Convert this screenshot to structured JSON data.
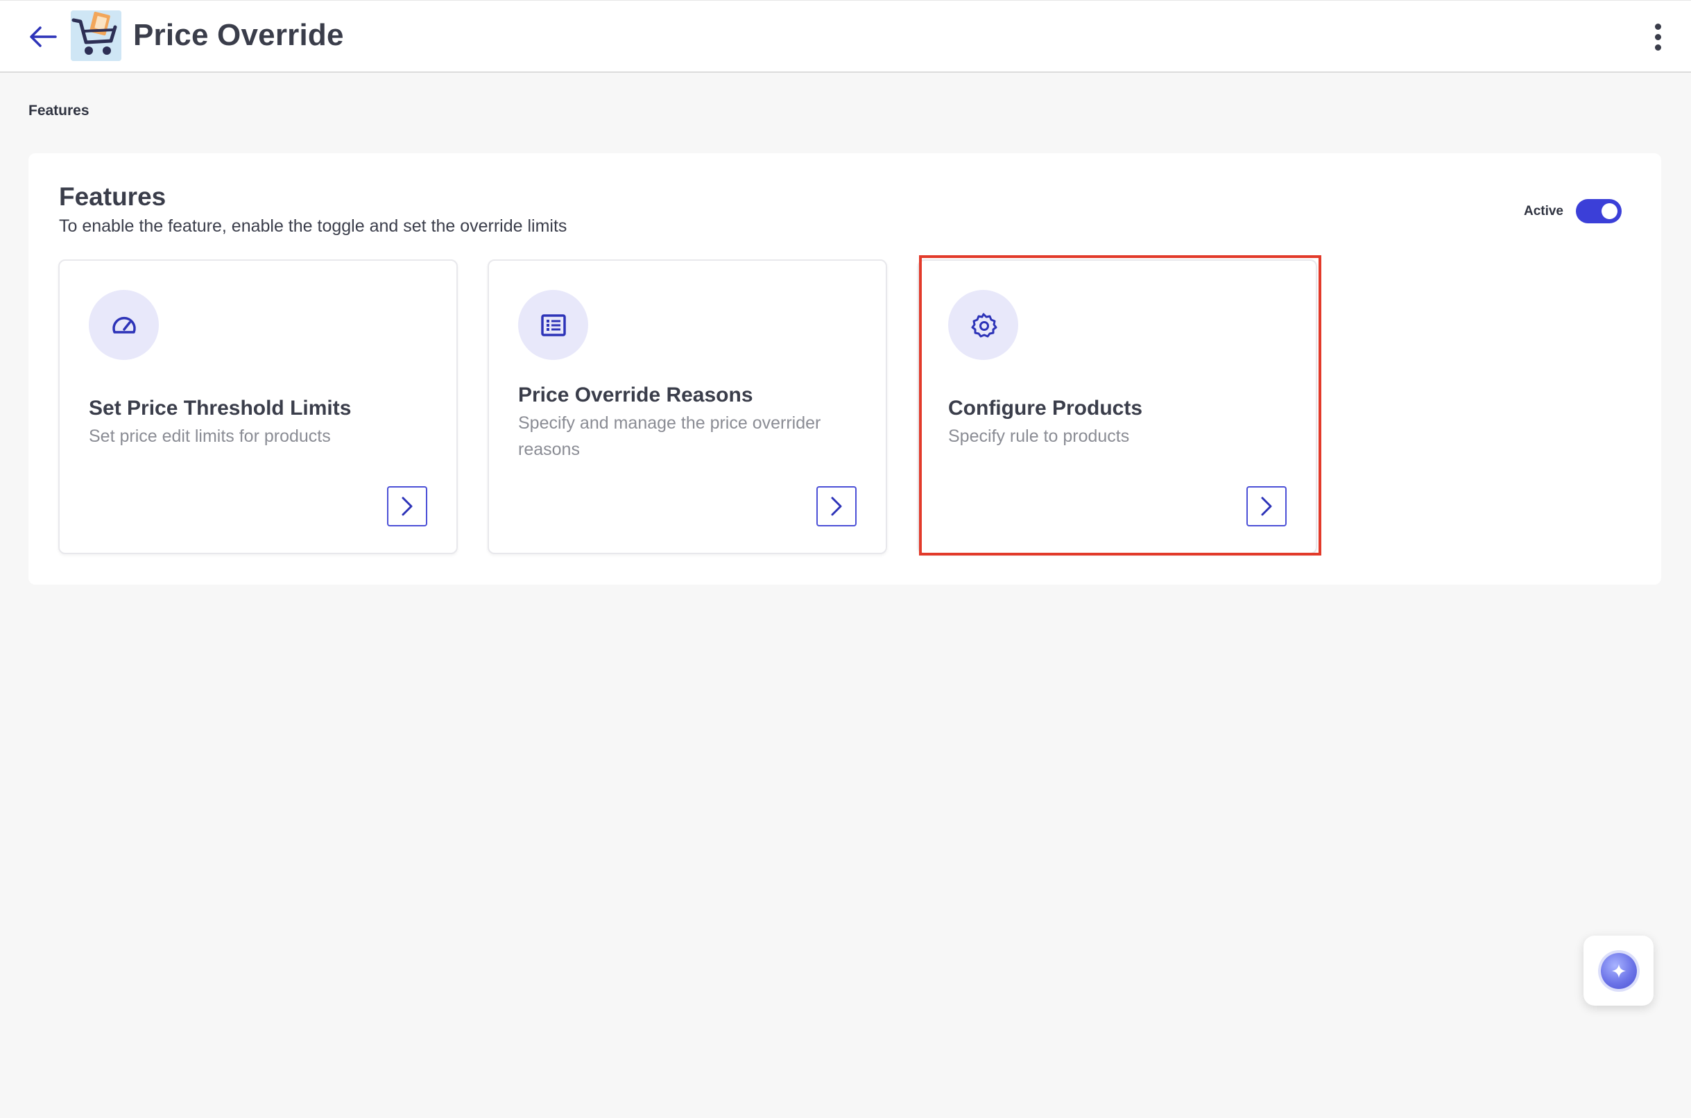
{
  "header": {
    "title": "Price Override",
    "back_icon": "arrow-left-icon",
    "logo_icon": "shopping-cart-logo-icon",
    "menu_icon": "more-vertical-icon"
  },
  "breadcrumb": "Features",
  "panel": {
    "title": "Features",
    "subtitle": "To enable the feature, enable the toggle and set the override limits",
    "status_label": "Active",
    "toggle_on": true
  },
  "cards": [
    {
      "icon": "speedometer-icon",
      "title": "Set Price Threshold Limits",
      "description": "Set price edit limits for products"
    },
    {
      "icon": "list-icon",
      "title": "Price Override Reasons",
      "description": "Specify and manage the price overrider reasons"
    },
    {
      "icon": "gear-icon",
      "title": "Configure Products",
      "description": "Specify rule to products"
    }
  ],
  "colors": {
    "accent": "#3b3fd8",
    "highlight": "#e23a2a",
    "background": "#f7f7f7"
  },
  "assistant_icon": "sparkle-icon"
}
